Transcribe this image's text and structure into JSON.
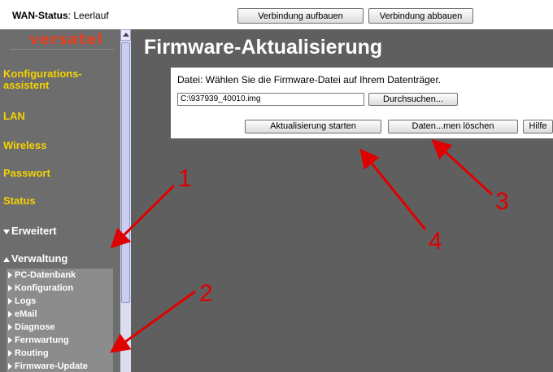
{
  "topbar": {
    "wan_label": "WAN-Status",
    "wan_value": "Leerlauf",
    "connect_button": "Verbindung aufbauen",
    "disconnect_button": "Verbindung abbauen"
  },
  "sidebar": {
    "logo": "versatel",
    "items": [
      {
        "line1": "Konfigurations-",
        "line2": "assistent"
      },
      {
        "label": "LAN"
      },
      {
        "label": "Wireless"
      },
      {
        "label": "Passwort"
      },
      {
        "label": "Status"
      },
      {
        "label": "Erweitert"
      },
      {
        "label": "Verwaltung"
      }
    ],
    "subitems": [
      "PC-Datenbank",
      "Konfiguration",
      "Logs",
      "eMail",
      "Diagnose",
      "Fernwartung",
      "Routing",
      "Firmware-Update"
    ]
  },
  "main": {
    "title": "Firmware-Aktualisierung",
    "instruction": "Datei: Wählen Sie die Firmware-Datei auf Ihrem Datenträger.",
    "file_value": "C:\\937939_40010.img",
    "browse_button": "Durchsuchen...",
    "start_button": "Aktualisierung starten",
    "delete_button": "Daten...men löschen",
    "help_button": "Hilfe"
  },
  "annotations": [
    "1",
    "2",
    "3",
    "4"
  ],
  "colors": {
    "sidebar_bg": "#6d6d6d",
    "nav_yellow": "#f5d200",
    "main_bg": "#5f5f5f",
    "annotation_red": "#e00000",
    "logo_red": "#e0401f"
  }
}
